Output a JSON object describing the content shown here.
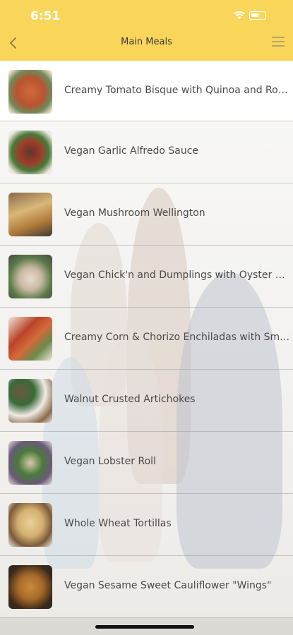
{
  "status_bar": {
    "time": "6:51"
  },
  "header": {
    "title": "Main Meals"
  },
  "colors": {
    "header_bg": "#f9d55a",
    "text": "#4a4a4a"
  },
  "items": [
    {
      "label": "Creamy Tomato Bisque with Quinoa and Roasted Chickpeas",
      "icon": "food-photo"
    },
    {
      "label": "Vegan Garlic Alfredo Sauce",
      "icon": "food-photo"
    },
    {
      "label": "Vegan Mushroom Wellington",
      "icon": "food-photo"
    },
    {
      "label": "Vegan Chick'n and Dumplings with Oyster Mushrooms",
      "icon": "food-photo"
    },
    {
      "label": "Creamy Corn & Chorizo Enchiladas with Smoky Sauce",
      "icon": "food-photo"
    },
    {
      "label": "Walnut Crusted Artichokes",
      "icon": "food-photo"
    },
    {
      "label": "Vegan Lobster Roll",
      "icon": "food-photo"
    },
    {
      "label": "Whole Wheat Tortillas",
      "icon": "food-photo"
    },
    {
      "label": "Vegan Sesame Sweet Cauliflower \"Wings\"",
      "icon": "food-photo"
    }
  ]
}
